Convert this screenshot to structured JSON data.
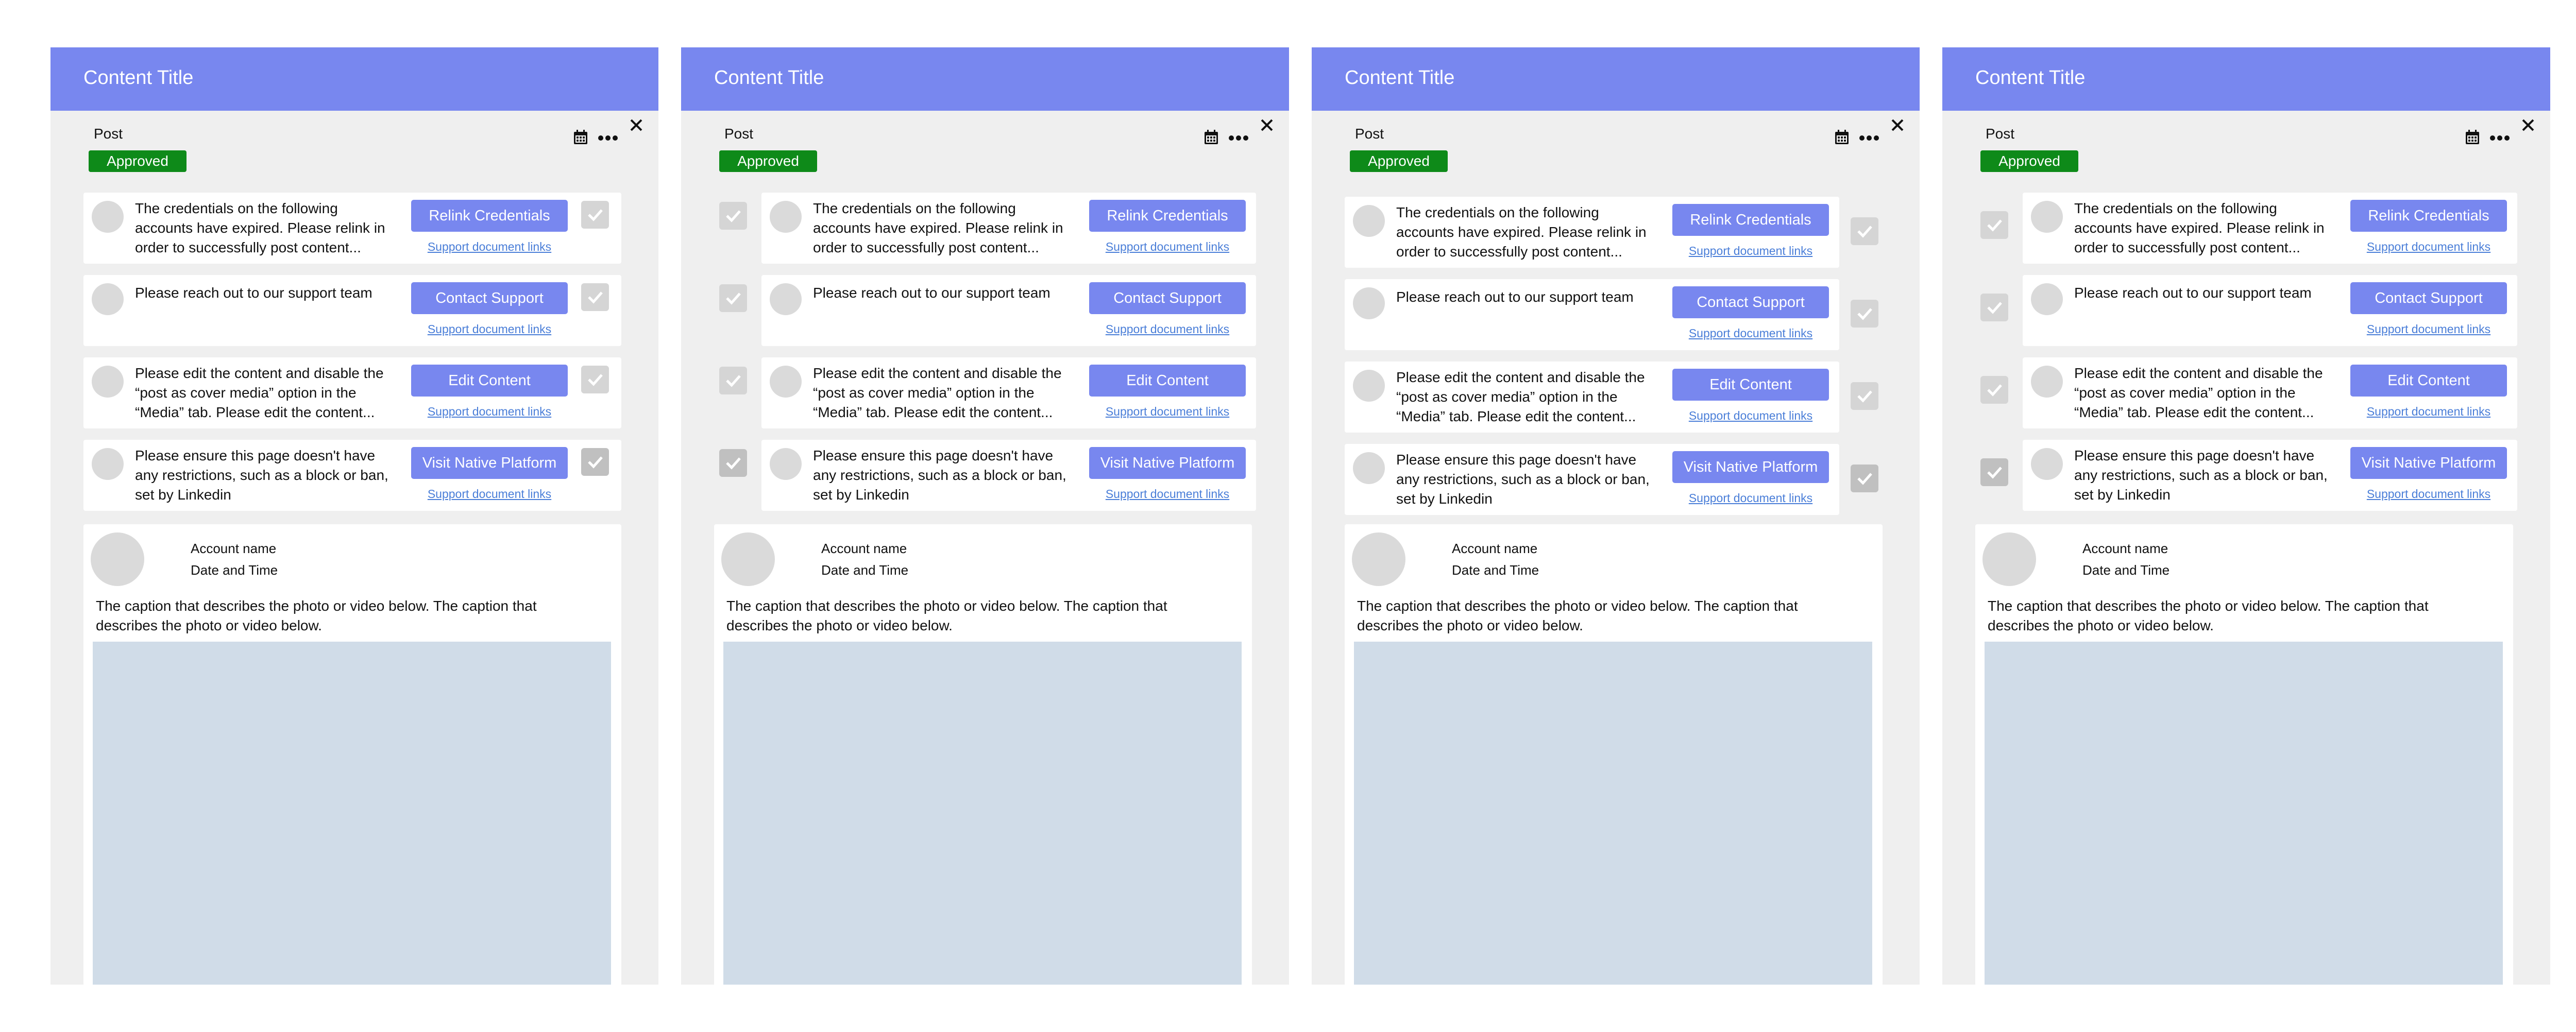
{
  "panels": [
    {
      "title": "Content Title",
      "post_label": "Post",
      "status": "Approved",
      "account_name": "Account name",
      "date_time": "Date and Time",
      "caption": "The caption that describes the photo or video below. The caption that describes the photo or video below.",
      "notifications": [
        {
          "message": "The credentials on the following accounts have expired. Please relink in order to successfully post content...",
          "button": "Relink Credentials",
          "link": "Support document links"
        },
        {
          "message": "Please reach out to our support team",
          "button": "Contact Support",
          "link": "Support document links"
        },
        {
          "message": "Please edit the content and disable the “post as cover media” option in the “Media” tab. Please edit the content...",
          "button": "Edit Content",
          "link": "Support document links"
        },
        {
          "message": "Please ensure this page doesn't have any restrictions, such as a block or ban, set by Linkedin",
          "button": "Visit Native Platform",
          "link": "Support document links"
        }
      ]
    },
    {
      "title": "Content Title",
      "post_label": "Post",
      "status": "Approved",
      "account_name": "Account name",
      "date_time": "Date and Time",
      "caption": "The caption that describes the photo or video below. The caption that describes the photo or video below.",
      "notifications": [
        {
          "message": "The credentials on the following accounts have expired. Please relink in order to successfully post content...",
          "button": "Relink Credentials",
          "link": "Support document links"
        },
        {
          "message": "Please reach out to our support team",
          "button": "Contact Support",
          "link": "Support document links"
        },
        {
          "message": "Please edit the content and disable the “post as cover media” option in the “Media” tab. Please edit the content...",
          "button": "Edit Content",
          "link": "Support document links"
        },
        {
          "message": "Please ensure this page doesn't have any restrictions, such as a block or ban, set by Linkedin",
          "button": "Visit Native Platform",
          "link": "Support document links"
        }
      ]
    },
    {
      "title": "Content Title",
      "post_label": "Post",
      "status": "Approved",
      "account_name": "Account name",
      "date_time": "Date and Time",
      "caption": "The caption that describes the photo or video below. The caption that describes the photo or video below.",
      "notifications": [
        {
          "message": "The credentials on the following accounts have expired. Please relink in order to successfully post content...",
          "button": "Relink Credentials",
          "link": "Support document links"
        },
        {
          "message": "Please reach out to our support team",
          "button": "Contact Support",
          "link": "Support document links"
        },
        {
          "message": "Please edit the content and disable the “post as cover media” option in the “Media” tab. Please edit the content...",
          "button": "Edit Content",
          "link": "Support document links"
        },
        {
          "message": "Please ensure this page doesn't have any restrictions, such as a block or ban, set by Linkedin",
          "button": "Visit Native Platform",
          "link": "Support document links"
        }
      ]
    },
    {
      "title": "Content Title",
      "post_label": "Post",
      "status": "Approved",
      "account_name": "Account name",
      "date_time": "Date and Time",
      "caption": "The caption that describes the photo or video below. The caption that describes the photo or video below.",
      "notifications": [
        {
          "message": "The credentials on the following accounts have expired. Please relink in order to successfully post content...",
          "button": "Relink Credentials",
          "link": "Support document links"
        },
        {
          "message": "Please reach out to our support team",
          "button": "Contact Support",
          "link": "Support document links"
        },
        {
          "message": "Please edit the content and disable the “post as cover media” option in the “Media” tab. Please edit the content...",
          "button": "Edit Content",
          "link": "Support document links"
        },
        {
          "message": "Please ensure this page doesn't have any restrictions, such as a block or ban, set by Linkedin",
          "button": "Visit Native Platform",
          "link": "Support document links"
        }
      ]
    }
  ],
  "colors": {
    "header": "#7887ef",
    "approved": "#0e8a19",
    "button": "#7887ef",
    "link": "#4a7ed8",
    "media_placeholder": "#d0dce8"
  },
  "icons": {
    "calendar": "calendar-icon",
    "more": "more-icon",
    "close": "close-icon",
    "check": "check-icon"
  }
}
